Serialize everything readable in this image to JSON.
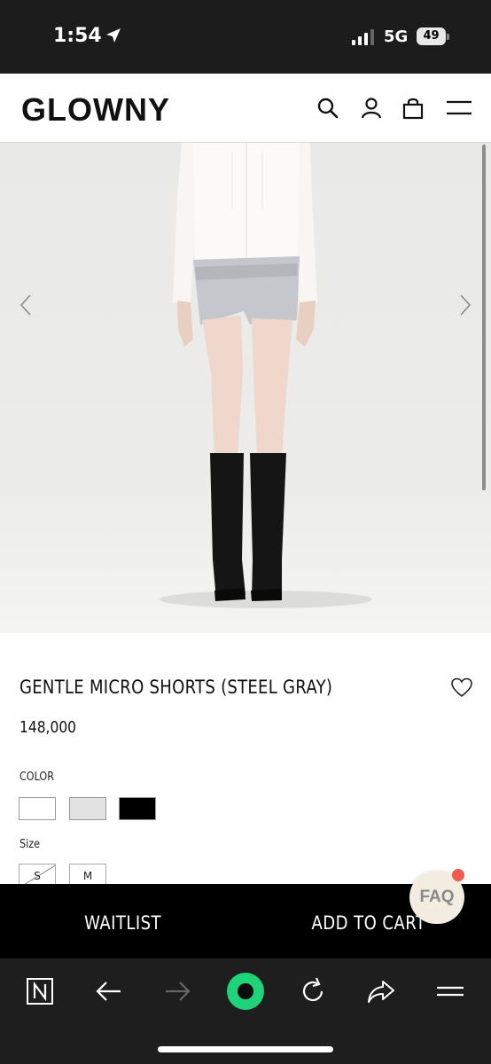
{
  "status_bar": {
    "time": "1:54",
    "network": "5G",
    "battery": "49"
  },
  "header": {
    "logo": "GLOWNY",
    "icons": [
      "search-icon",
      "account-icon",
      "cart-icon",
      "menu-icon"
    ]
  },
  "carousel": {
    "prev_icon": "chevron-left-icon",
    "next_icon": "chevron-right-icon"
  },
  "product": {
    "name": "GENTLE MICRO SHORTS (STEEL GRAY)",
    "price": "148,000",
    "color_label": "COLOR",
    "colors": [
      "#ffffff",
      "#e2e2e2",
      "#000000"
    ],
    "size_label": "Size",
    "sizes": [
      {
        "label": "S",
        "sold_out": true
      },
      {
        "label": "M",
        "sold_out": false
      }
    ]
  },
  "actions": {
    "waitlist": "WAITLIST",
    "add_to_cart": "ADD TO CART"
  },
  "faq": {
    "label": "FAQ"
  },
  "browser": {
    "icons": [
      "n-app-icon",
      "back-arrow-icon",
      "forward-arrow-icon",
      "assistant-icon",
      "reload-icon",
      "share-icon",
      "menu-icon"
    ],
    "accent": "#1ed37a"
  }
}
